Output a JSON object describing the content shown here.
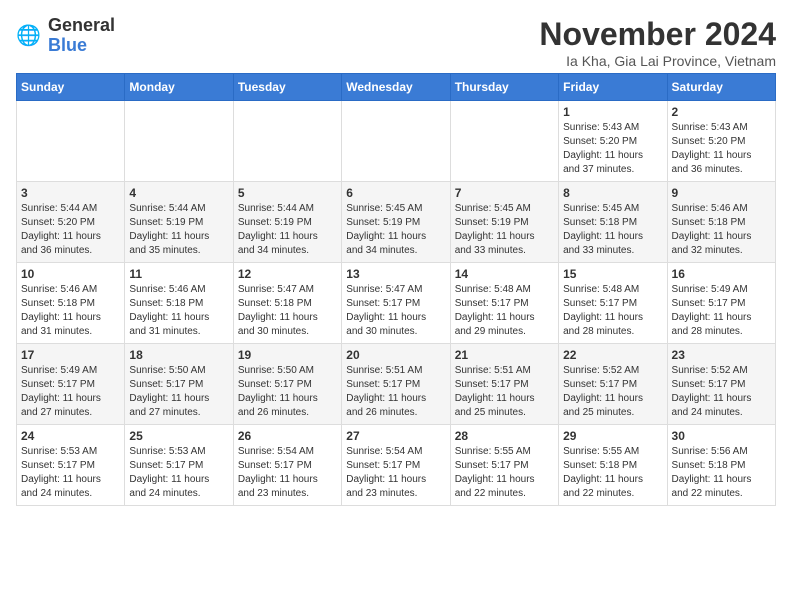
{
  "logo": {
    "general": "General",
    "blue": "Blue"
  },
  "title": "November 2024",
  "location": "Ia Kha, Gia Lai Province, Vietnam",
  "headers": [
    "Sunday",
    "Monday",
    "Tuesday",
    "Wednesday",
    "Thursday",
    "Friday",
    "Saturday"
  ],
  "weeks": [
    [
      {
        "day": "",
        "info": ""
      },
      {
        "day": "",
        "info": ""
      },
      {
        "day": "",
        "info": ""
      },
      {
        "day": "",
        "info": ""
      },
      {
        "day": "",
        "info": ""
      },
      {
        "day": "1",
        "info": "Sunrise: 5:43 AM\nSunset: 5:20 PM\nDaylight: 11 hours\nand 37 minutes."
      },
      {
        "day": "2",
        "info": "Sunrise: 5:43 AM\nSunset: 5:20 PM\nDaylight: 11 hours\nand 36 minutes."
      }
    ],
    [
      {
        "day": "3",
        "info": "Sunrise: 5:44 AM\nSunset: 5:20 PM\nDaylight: 11 hours\nand 36 minutes."
      },
      {
        "day": "4",
        "info": "Sunrise: 5:44 AM\nSunset: 5:19 PM\nDaylight: 11 hours\nand 35 minutes."
      },
      {
        "day": "5",
        "info": "Sunrise: 5:44 AM\nSunset: 5:19 PM\nDaylight: 11 hours\nand 34 minutes."
      },
      {
        "day": "6",
        "info": "Sunrise: 5:45 AM\nSunset: 5:19 PM\nDaylight: 11 hours\nand 34 minutes."
      },
      {
        "day": "7",
        "info": "Sunrise: 5:45 AM\nSunset: 5:19 PM\nDaylight: 11 hours\nand 33 minutes."
      },
      {
        "day": "8",
        "info": "Sunrise: 5:45 AM\nSunset: 5:18 PM\nDaylight: 11 hours\nand 33 minutes."
      },
      {
        "day": "9",
        "info": "Sunrise: 5:46 AM\nSunset: 5:18 PM\nDaylight: 11 hours\nand 32 minutes."
      }
    ],
    [
      {
        "day": "10",
        "info": "Sunrise: 5:46 AM\nSunset: 5:18 PM\nDaylight: 11 hours\nand 31 minutes."
      },
      {
        "day": "11",
        "info": "Sunrise: 5:46 AM\nSunset: 5:18 PM\nDaylight: 11 hours\nand 31 minutes."
      },
      {
        "day": "12",
        "info": "Sunrise: 5:47 AM\nSunset: 5:18 PM\nDaylight: 11 hours\nand 30 minutes."
      },
      {
        "day": "13",
        "info": "Sunrise: 5:47 AM\nSunset: 5:17 PM\nDaylight: 11 hours\nand 30 minutes."
      },
      {
        "day": "14",
        "info": "Sunrise: 5:48 AM\nSunset: 5:17 PM\nDaylight: 11 hours\nand 29 minutes."
      },
      {
        "day": "15",
        "info": "Sunrise: 5:48 AM\nSunset: 5:17 PM\nDaylight: 11 hours\nand 28 minutes."
      },
      {
        "day": "16",
        "info": "Sunrise: 5:49 AM\nSunset: 5:17 PM\nDaylight: 11 hours\nand 28 minutes."
      }
    ],
    [
      {
        "day": "17",
        "info": "Sunrise: 5:49 AM\nSunset: 5:17 PM\nDaylight: 11 hours\nand 27 minutes."
      },
      {
        "day": "18",
        "info": "Sunrise: 5:50 AM\nSunset: 5:17 PM\nDaylight: 11 hours\nand 27 minutes."
      },
      {
        "day": "19",
        "info": "Sunrise: 5:50 AM\nSunset: 5:17 PM\nDaylight: 11 hours\nand 26 minutes."
      },
      {
        "day": "20",
        "info": "Sunrise: 5:51 AM\nSunset: 5:17 PM\nDaylight: 11 hours\nand 26 minutes."
      },
      {
        "day": "21",
        "info": "Sunrise: 5:51 AM\nSunset: 5:17 PM\nDaylight: 11 hours\nand 25 minutes."
      },
      {
        "day": "22",
        "info": "Sunrise: 5:52 AM\nSunset: 5:17 PM\nDaylight: 11 hours\nand 25 minutes."
      },
      {
        "day": "23",
        "info": "Sunrise: 5:52 AM\nSunset: 5:17 PM\nDaylight: 11 hours\nand 24 minutes."
      }
    ],
    [
      {
        "day": "24",
        "info": "Sunrise: 5:53 AM\nSunset: 5:17 PM\nDaylight: 11 hours\nand 24 minutes."
      },
      {
        "day": "25",
        "info": "Sunrise: 5:53 AM\nSunset: 5:17 PM\nDaylight: 11 hours\nand 24 minutes."
      },
      {
        "day": "26",
        "info": "Sunrise: 5:54 AM\nSunset: 5:17 PM\nDaylight: 11 hours\nand 23 minutes."
      },
      {
        "day": "27",
        "info": "Sunrise: 5:54 AM\nSunset: 5:17 PM\nDaylight: 11 hours\nand 23 minutes."
      },
      {
        "day": "28",
        "info": "Sunrise: 5:55 AM\nSunset: 5:17 PM\nDaylight: 11 hours\nand 22 minutes."
      },
      {
        "day": "29",
        "info": "Sunrise: 5:55 AM\nSunset: 5:18 PM\nDaylight: 11 hours\nand 22 minutes."
      },
      {
        "day": "30",
        "info": "Sunrise: 5:56 AM\nSunset: 5:18 PM\nDaylight: 11 hours\nand 22 minutes."
      }
    ]
  ]
}
